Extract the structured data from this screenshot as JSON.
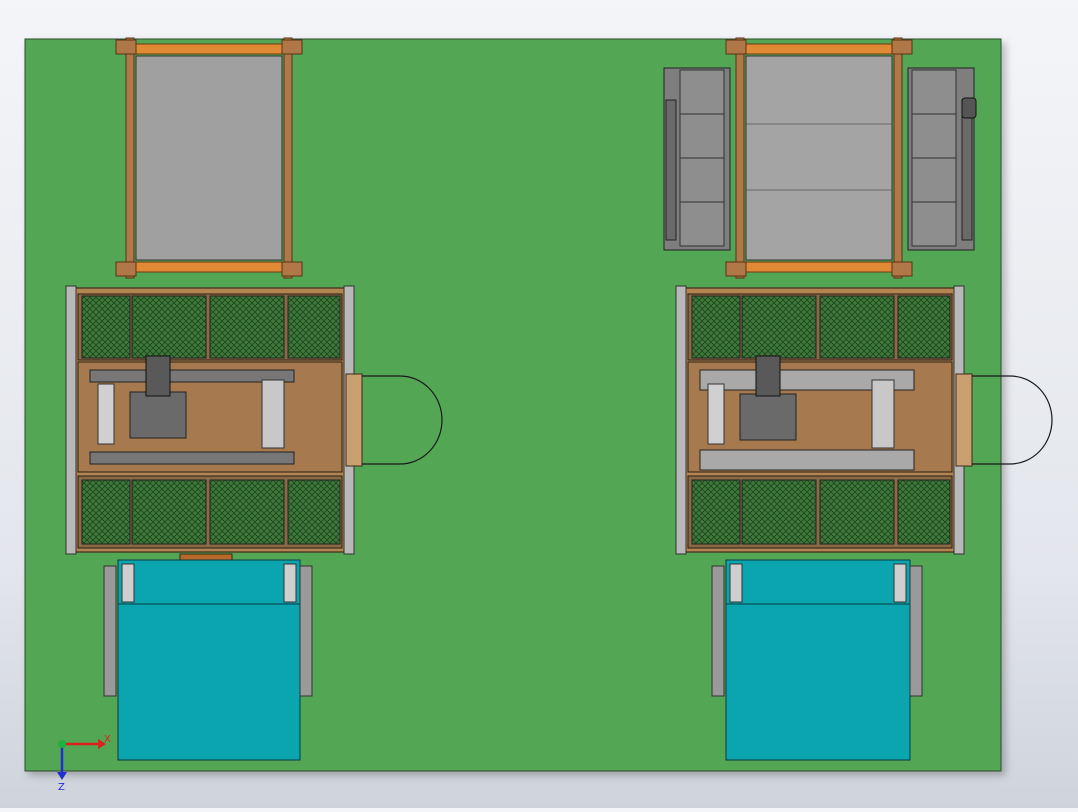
{
  "viewport": {
    "background": "#e6e8ee",
    "floor_color": "#52a653",
    "frame_color": "#a26e3e",
    "rail_color": "#e08a35",
    "panel_color": "#9e9e9e",
    "mesh_color": "#3f7a3c",
    "wood_color": "#a8774c",
    "cyan_color": "#0ba5b0",
    "machine_gray": "#8c8c8c"
  },
  "triad": {
    "x_label": "X",
    "z_label": "Z",
    "x_color": "#e02020",
    "z_color": "#2030d0",
    "origin_color": "#20b040"
  }
}
